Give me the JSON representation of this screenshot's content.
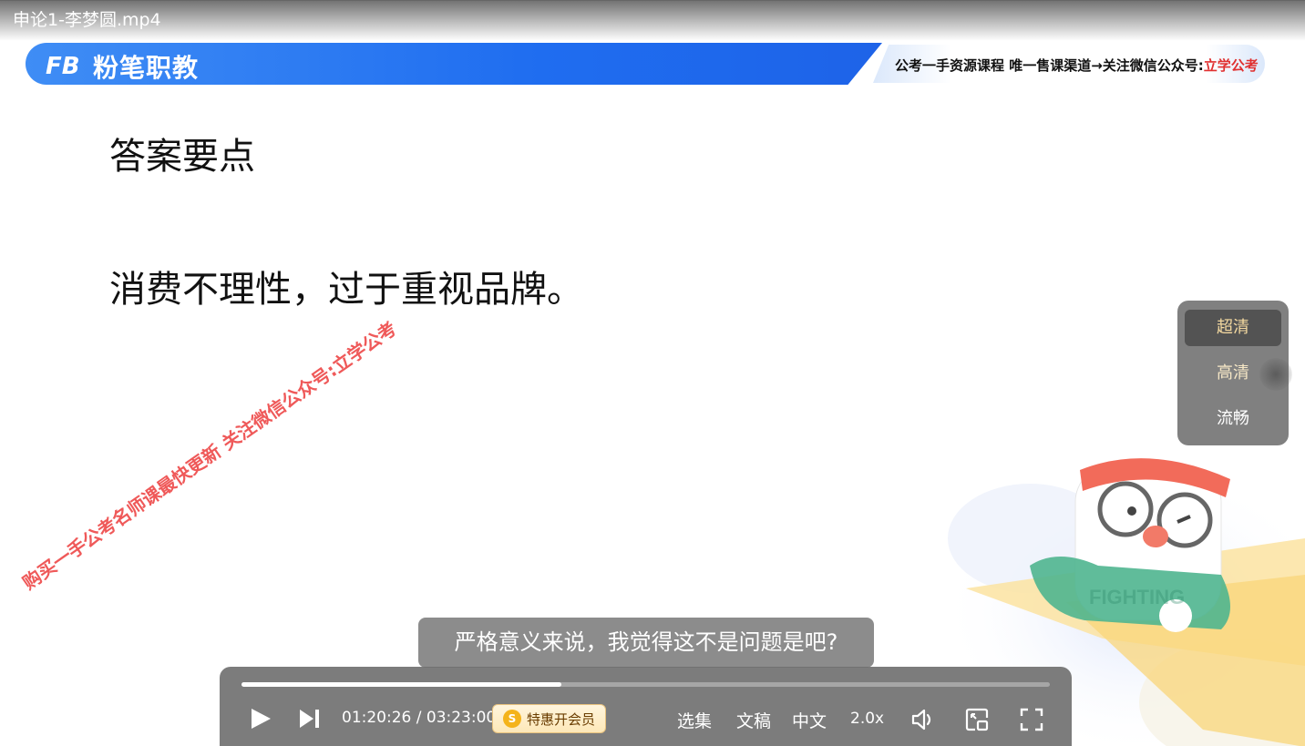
{
  "window": {
    "file_title": "申论1-李梦圆.mp4"
  },
  "slide": {
    "brand_mark": "FB",
    "brand_name": "粉笔职教",
    "banner_notice_prefix": "公考一手资源课程 唯一售课渠道→关注微信公众号:",
    "banner_notice_highlight": "立学公考",
    "heading": "答案要点",
    "body": "消费不理性，过于重视品牌。",
    "watermark": "购买一手公考名师课最快更新 关注微信公众号:立学公考",
    "art_caption": "FIGHTING"
  },
  "quality_menu": {
    "items": [
      {
        "label": "超清",
        "active": true
      },
      {
        "label": "高清",
        "active": false
      },
      {
        "label": "流畅",
        "active": false
      }
    ]
  },
  "subtitle": "严格意义来说，我觉得这不是问题是吧?",
  "controls": {
    "current_time": "01:20:26",
    "duration": "03:23:00",
    "time_display": "01:20:26 / 03:23:00",
    "progress_fraction": 0.396,
    "vip_label": "特惠开会员",
    "vip_coin": "S",
    "episodes_label": "选集",
    "transcript_label": "文稿",
    "language_label": "中文",
    "speed_label": "2.0x"
  },
  "colors": {
    "brand_blue": "#1f6df0",
    "watermark_red": "#ee4c4c",
    "highlight_red": "#e03030",
    "vip_gold": "#f4b31a"
  },
  "icons": [
    "play-icon",
    "next-icon",
    "volume-icon",
    "picture-in-picture-icon",
    "fullscreen-icon"
  ]
}
